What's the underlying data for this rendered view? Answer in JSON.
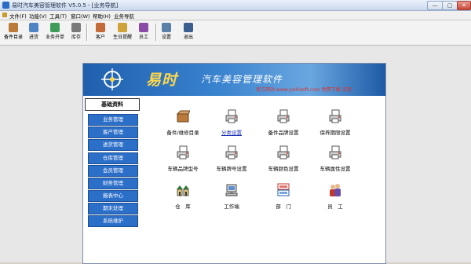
{
  "window": {
    "title": "易时汽车美容管理软件 V5.0.5 - [业务导航]",
    "min": "—",
    "max": "▢",
    "close": "✕"
  },
  "menu": [
    "文件(F)",
    "功能(V)",
    "工具(T)",
    "窗口(W)",
    "帮助(H)",
    "业务导航"
  ],
  "toolbar": [
    {
      "label": "备件目录",
      "icon": "parts-box-icon",
      "color": "#b97a3a"
    },
    {
      "label": "进货",
      "icon": "stock-in-icon",
      "color": "#4e84c4"
    },
    {
      "label": "业务开单",
      "icon": "order-icon",
      "color": "#3f9b5a"
    },
    {
      "label": "库存",
      "icon": "inventory-icon",
      "color": "#7a7a7a"
    },
    {
      "label": "客户",
      "icon": "customer-icon",
      "color": "#c46a3a"
    },
    {
      "label": "生日提醒",
      "icon": "birthday-icon",
      "color": "#d0a23a"
    },
    {
      "label": "员工",
      "icon": "employee-icon",
      "color": "#8a4aa8"
    },
    {
      "label": "设置",
      "icon": "settings-icon",
      "color": "#5a7fa8"
    },
    {
      "label": "退出",
      "icon": "exit-icon",
      "color": "#3a5e8f"
    }
  ],
  "banner": {
    "brand": "易时",
    "title": "汽车美容管理软件",
    "subtitle": "官方网站 www.yishisoft.com 免费下载 试用"
  },
  "nav": {
    "header": "基础资料",
    "items": [
      "业务管理",
      "客户管理",
      "进货管理",
      "仓库管理",
      "会员管理",
      "财务管理",
      "报表中心",
      "期末处理",
      "系统维护"
    ]
  },
  "grid": [
    {
      "label": "备件/维修目录",
      "icon": "parts-box-icon",
      "link": false
    },
    {
      "label": "分类设置",
      "icon": "printer-doc-icon",
      "link": true
    },
    {
      "label": "备件品牌设置",
      "icon": "printer-doc-icon",
      "link": false
    },
    {
      "label": "保养期限设置",
      "icon": "printer-doc-icon",
      "link": false
    },
    {
      "label": "车辆品牌型号",
      "icon": "printer-doc-icon",
      "link": false
    },
    {
      "label": "车辆牌号设置",
      "icon": "printer-doc-icon",
      "link": false
    },
    {
      "label": "车辆颜色设置",
      "icon": "printer-doc-icon",
      "link": false
    },
    {
      "label": "车辆属性设置",
      "icon": "printer-doc-icon",
      "link": false
    },
    {
      "label": "仓　库",
      "icon": "warehouse-icon",
      "link": false
    },
    {
      "label": "工作端",
      "icon": "computer-icon",
      "link": false
    },
    {
      "label": "部　门",
      "icon": "department-icon",
      "link": false
    },
    {
      "label": "员　工",
      "icon": "staff-icon",
      "link": false
    }
  ]
}
